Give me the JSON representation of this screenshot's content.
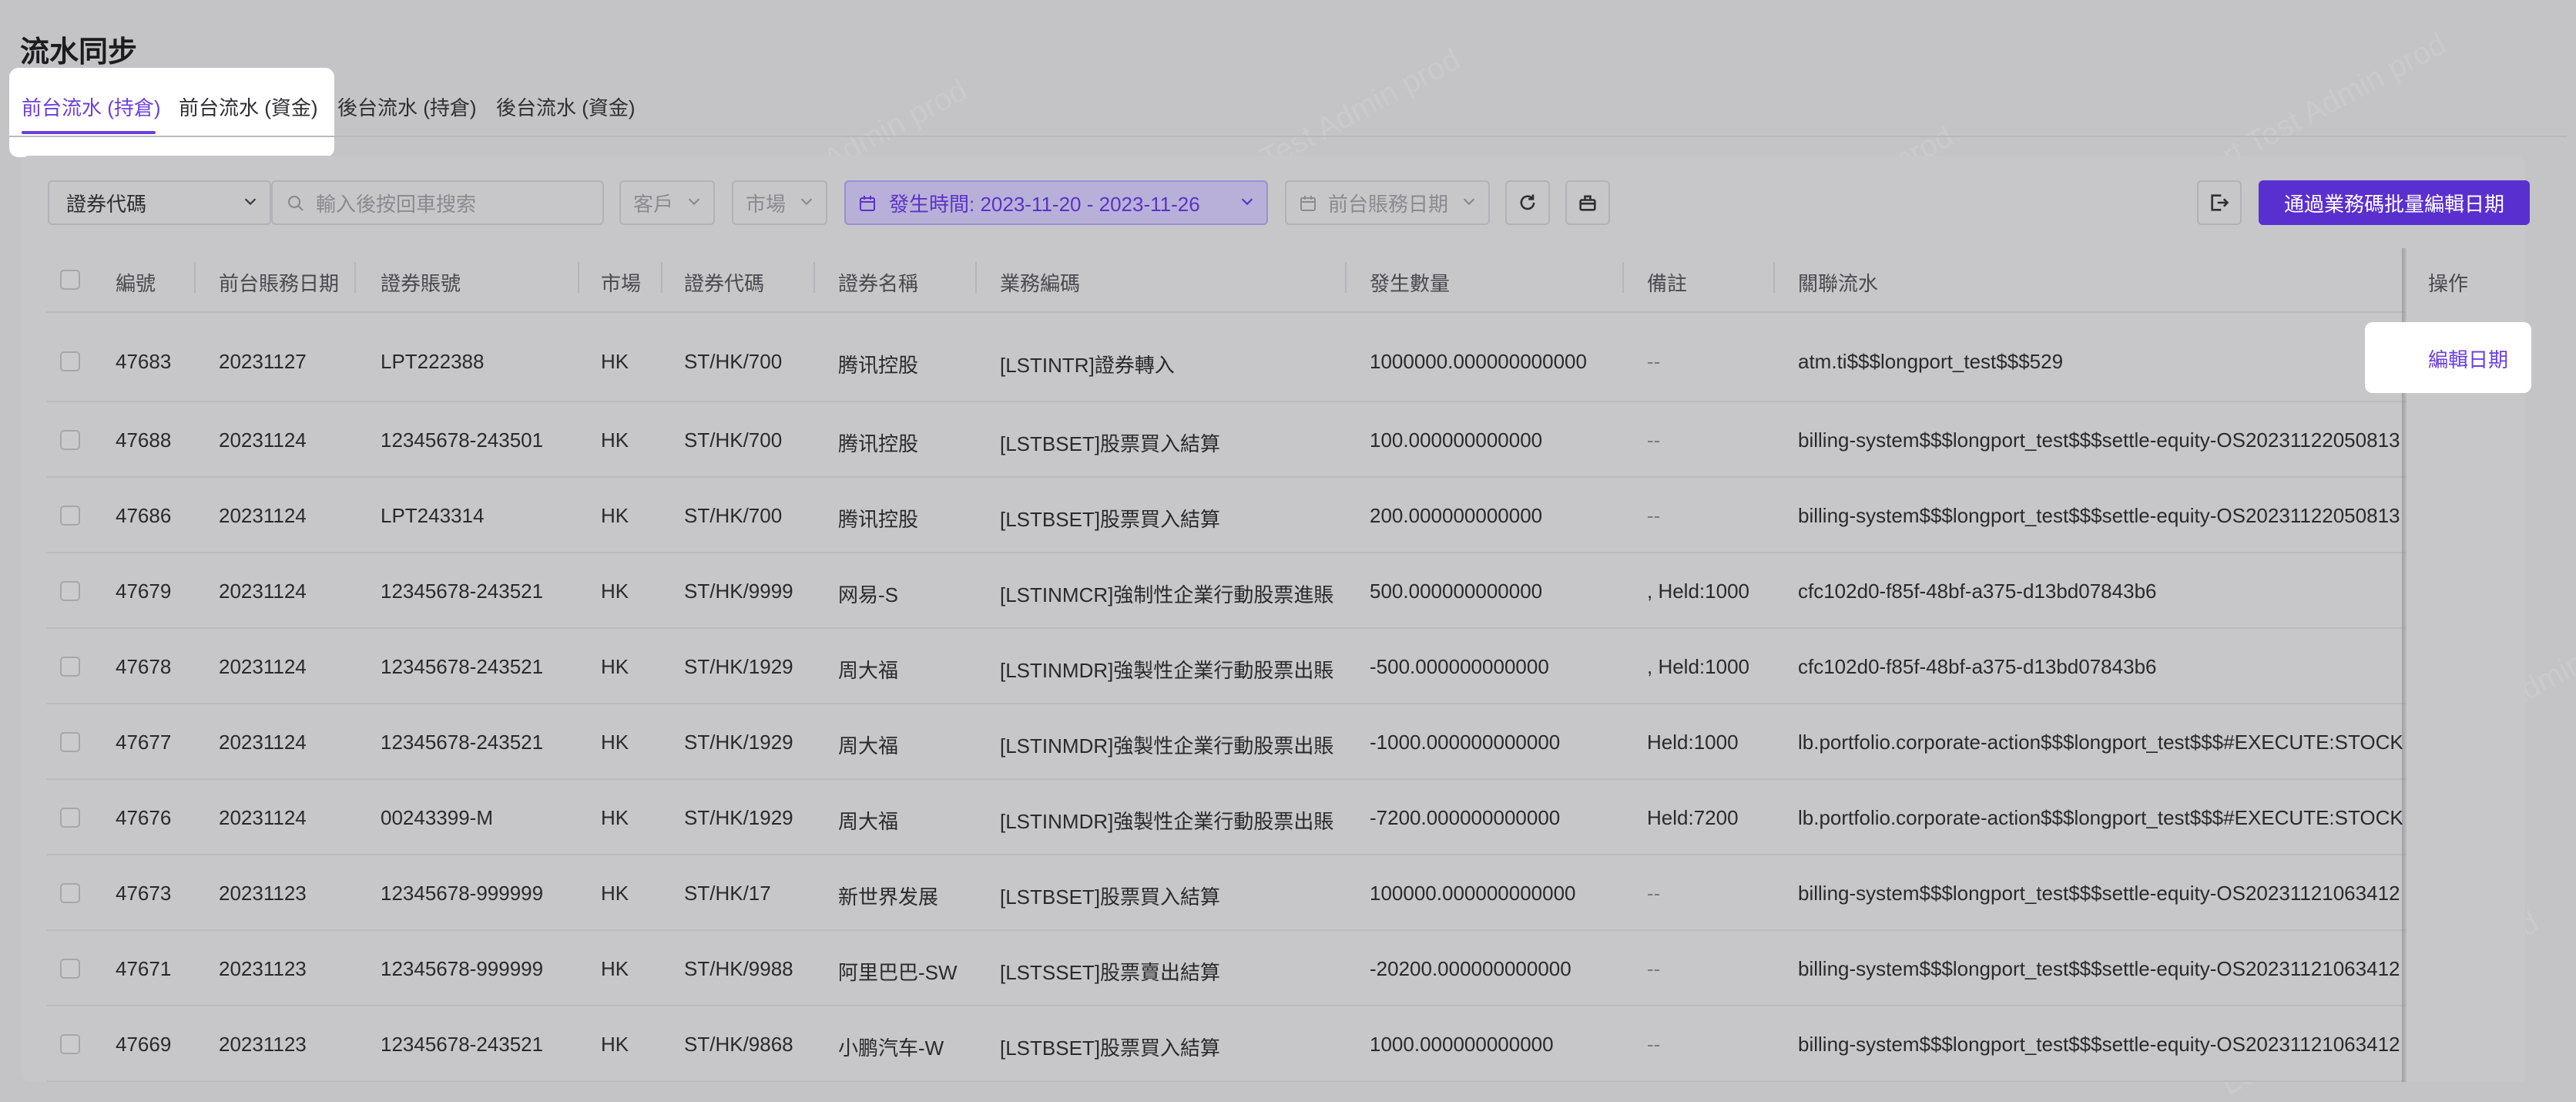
{
  "page": {
    "title": "流水同步"
  },
  "tabs": [
    {
      "label": "前台流水 (持倉)",
      "active": true
    },
    {
      "label": "前台流水 (資金)",
      "active": false
    },
    {
      "label": "後台流水 (持倉)",
      "active": false
    },
    {
      "label": "後台流水 (資金)",
      "active": false
    }
  ],
  "filters": {
    "security_type": "證券代碼",
    "search_placeholder": "輸入後按回車搜索",
    "customer": "客戶",
    "market": "市場",
    "date_range": "發生時間: 2023-11-20 - 2023-11-26",
    "front_date": "前台賬務日期"
  },
  "toolbar": {
    "refresh_icon": "refresh-icon",
    "clear_icon": "clear-filter-icon",
    "export_icon": "export-icon",
    "batch_button": "通過業務碼批量編輯日期"
  },
  "table": {
    "columns": [
      "編號",
      "前台賬務日期",
      "證券賬號",
      "市場",
      "證券代碼",
      "證券名稱",
      "業務編碼",
      "發生數量",
      "備註",
      "關聯流水",
      "操作"
    ],
    "rows": [
      {
        "id": "47683",
        "date": "20231127",
        "account": "LPT222388",
        "market": "HK",
        "code": "ST/HK/700",
        "name": "腾讯控股",
        "biz": "[LSTINTR]證券轉入",
        "qty": "1000000.000000000000",
        "note": "--",
        "related": "atm.ti$$$longport_test$$$529",
        "action": "編輯日期"
      },
      {
        "id": "47688",
        "date": "20231124",
        "account": "12345678-243501",
        "market": "HK",
        "code": "ST/HK/700",
        "name": "腾讯控股",
        "biz": "[LSTBSET]股票買入結算",
        "qty": "100.000000000000",
        "note": "--",
        "related": "billing-system$$$longport_test$$$settle-equity-OS20231122050813",
        "action": ""
      },
      {
        "id": "47686",
        "date": "20231124",
        "account": "LPT243314",
        "market": "HK",
        "code": "ST/HK/700",
        "name": "腾讯控股",
        "biz": "[LSTBSET]股票買入結算",
        "qty": "200.000000000000",
        "note": "--",
        "related": "billing-system$$$longport_test$$$settle-equity-OS20231122050813",
        "action": ""
      },
      {
        "id": "47679",
        "date": "20231124",
        "account": "12345678-243521",
        "market": "HK",
        "code": "ST/HK/9999",
        "name": "网易-S",
        "biz": "[LSTINMCR]強制性企業行動股票進賬",
        "qty": "500.000000000000",
        "note": ", Held:1000",
        "related": "cfc102d0-f85f-48bf-a375-d13bd07843b6",
        "action": ""
      },
      {
        "id": "47678",
        "date": "20231124",
        "account": "12345678-243521",
        "market": "HK",
        "code": "ST/HK/1929",
        "name": "周大福",
        "biz": "[LSTINMDR]強製性企業行動股票出賬",
        "qty": "-500.000000000000",
        "note": ", Held:1000",
        "related": "cfc102d0-f85f-48bf-a375-d13bd07843b6",
        "action": ""
      },
      {
        "id": "47677",
        "date": "20231124",
        "account": "12345678-243521",
        "market": "HK",
        "code": "ST/HK/1929",
        "name": "周大福",
        "biz": "[LSTINMDR]強製性企業行動股票出賬",
        "qty": "-1000.000000000000",
        "note": "Held:1000",
        "related": "lb.portfolio.corporate-action$$$longport_test$$$#EXECUTE:STOCK",
        "action": ""
      },
      {
        "id": "47676",
        "date": "20231124",
        "account": "00243399-M",
        "market": "HK",
        "code": "ST/HK/1929",
        "name": "周大福",
        "biz": "[LSTINMDR]強製性企業行動股票出賬",
        "qty": "-7200.000000000000",
        "note": "Held:7200",
        "related": "lb.portfolio.corporate-action$$$longport_test$$$#EXECUTE:STOCK",
        "action": ""
      },
      {
        "id": "47673",
        "date": "20231123",
        "account": "12345678-999999",
        "market": "HK",
        "code": "ST/HK/17",
        "name": "新世界发展",
        "biz": "[LSTBSET]股票買入結算",
        "qty": "100000.000000000000",
        "note": "--",
        "related": "billing-system$$$longport_test$$$settle-equity-OS20231121063412",
        "action": ""
      },
      {
        "id": "47671",
        "date": "20231123",
        "account": "12345678-999999",
        "market": "HK",
        "code": "ST/HK/9988",
        "name": "阿里巴巴-SW",
        "biz": "[LSTSSET]股票賣出結算",
        "qty": "-20200.000000000000",
        "note": "--",
        "related": "billing-system$$$longport_test$$$settle-equity-OS20231121063412",
        "action": ""
      },
      {
        "id": "47669",
        "date": "20231123",
        "account": "12345678-243521",
        "market": "HK",
        "code": "ST/HK/9868",
        "name": "小鹏汽车-W",
        "biz": "[LSTBSET]股票買入結算",
        "qty": "1000.000000000000",
        "note": "--",
        "related": "billing-system$$$longport_test$$$settle-equity-OS20231121063412",
        "action": ""
      }
    ]
  },
  "watermark": {
    "text": "LongPort Test Admin prod"
  },
  "colors": {
    "accent": "#6b3fe0",
    "primary_button": "#5a2fd0",
    "overlay": "#c4c4c7"
  }
}
